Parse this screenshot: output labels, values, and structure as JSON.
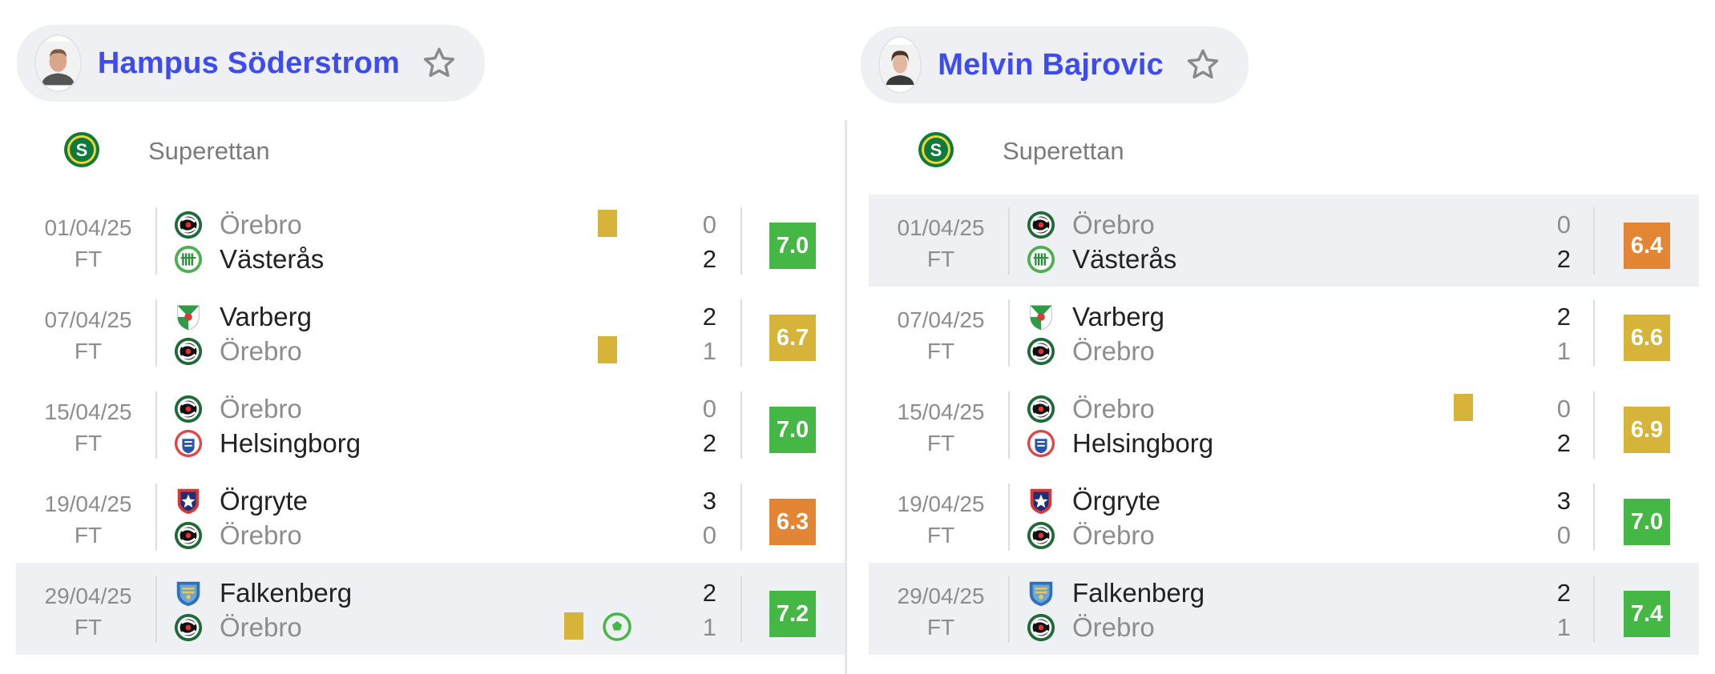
{
  "colors": {
    "rating_green": "#44b745",
    "rating_yellow": "#d6b43a",
    "rating_orange": "#e28534",
    "player_name": "#3c4cf0",
    "row_highlight": "#eef0f4"
  },
  "icons": {
    "favorite": "star-outline-icon",
    "league": "superettan-logo",
    "goal": "football-icon",
    "booking": "yellow-card"
  },
  "players": [
    {
      "name": "Hampus Söderstrom",
      "league": "Superettan",
      "matches": [
        {
          "date": "01/04/25",
          "status": "FT",
          "home": "Örebro",
          "away": "Västerås",
          "home_score": "0",
          "away_score": "2",
          "rating": "7.0",
          "rating_level": "green",
          "highlighted": false,
          "yellow_card_on": "home",
          "goal": false
        },
        {
          "date": "07/04/25",
          "status": "FT",
          "home": "Varberg",
          "away": "Örebro",
          "home_score": "2",
          "away_score": "1",
          "rating": "6.7",
          "rating_level": "yellow",
          "highlighted": false,
          "yellow_card_on": "away",
          "goal": false
        },
        {
          "date": "15/04/25",
          "status": "FT",
          "home": "Örebro",
          "away": "Helsingborg",
          "home_score": "0",
          "away_score": "2",
          "rating": "7.0",
          "rating_level": "green",
          "highlighted": false,
          "yellow_card_on": null,
          "goal": false
        },
        {
          "date": "19/04/25",
          "status": "FT",
          "home": "Örgryte",
          "away": "Örebro",
          "home_score": "3",
          "away_score": "0",
          "rating": "6.3",
          "rating_level": "orange",
          "highlighted": false,
          "yellow_card_on": null,
          "goal": false
        },
        {
          "date": "29/04/25",
          "status": "FT",
          "home": "Falkenberg",
          "away": "Örebro",
          "home_score": "2",
          "away_score": "1",
          "rating": "7.2",
          "rating_level": "green",
          "highlighted": true,
          "yellow_card_on": "away",
          "goal": true
        }
      ]
    },
    {
      "name": "Melvin Bajrovic",
      "league": "Superettan",
      "matches": [
        {
          "date": "01/04/25",
          "status": "FT",
          "home": "Örebro",
          "away": "Västerås",
          "home_score": "0",
          "away_score": "2",
          "rating": "6.4",
          "rating_level": "orange",
          "highlighted": true,
          "yellow_card_on": null,
          "goal": false
        },
        {
          "date": "07/04/25",
          "status": "FT",
          "home": "Varberg",
          "away": "Örebro",
          "home_score": "2",
          "away_score": "1",
          "rating": "6.6",
          "rating_level": "yellow",
          "highlighted": false,
          "yellow_card_on": null,
          "goal": false
        },
        {
          "date": "15/04/25",
          "status": "FT",
          "home": "Örebro",
          "away": "Helsingborg",
          "home_score": "0",
          "away_score": "2",
          "rating": "6.9",
          "rating_level": "yellow",
          "highlighted": false,
          "yellow_card_on": "home",
          "goal": false
        },
        {
          "date": "19/04/25",
          "status": "FT",
          "home": "Örgryte",
          "away": "Örebro",
          "home_score": "3",
          "away_score": "0",
          "rating": "7.0",
          "rating_level": "green",
          "highlighted": false,
          "yellow_card_on": null,
          "goal": false
        },
        {
          "date": "29/04/25",
          "status": "FT",
          "home": "Falkenberg",
          "away": "Örebro",
          "home_score": "2",
          "away_score": "1",
          "rating": "7.4",
          "rating_level": "green",
          "highlighted": true,
          "yellow_card_on": null,
          "goal": false
        }
      ]
    }
  ]
}
